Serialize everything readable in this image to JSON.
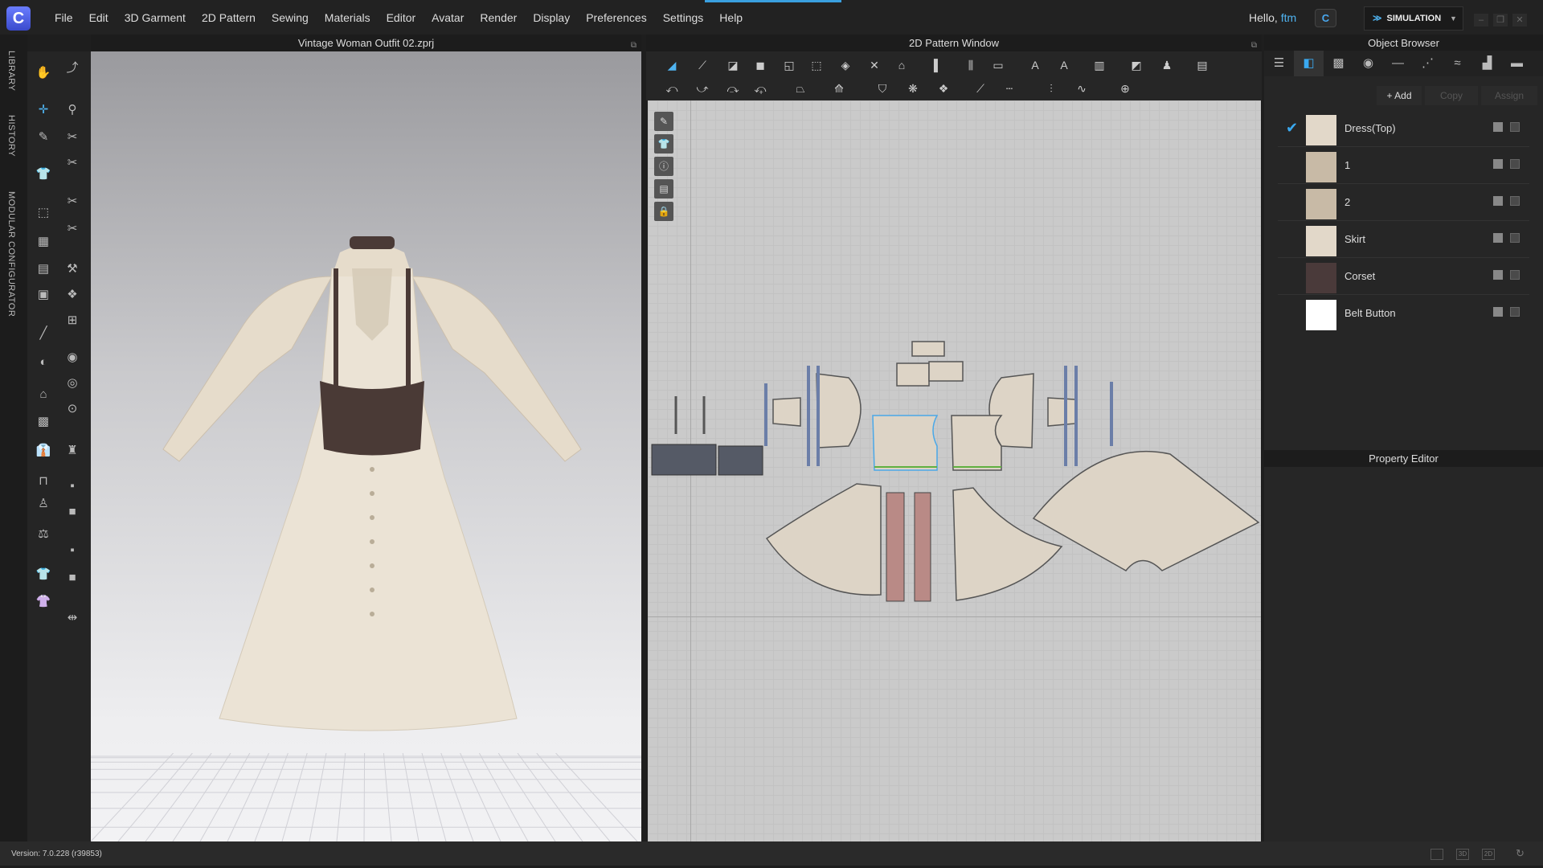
{
  "app": {
    "logo": "C",
    "menu": [
      "File",
      "Edit",
      "3D Garment",
      "2D Pattern",
      "Sewing",
      "Materials",
      "Editor",
      "Avatar",
      "Render",
      "Display",
      "Preferences",
      "Settings",
      "Help"
    ],
    "greeting": "Hello,",
    "user": "ftm",
    "cloud_icon": "C",
    "mode": "SIMULATION",
    "window_buttons": [
      "–",
      "❐",
      "✕"
    ]
  },
  "side_tabs": [
    "LIBRARY",
    "HISTORY",
    "MODULAR CONFIGURATOR"
  ],
  "viewport3d": {
    "title": "Vintage Woman Outfit 02.zprj"
  },
  "pattern2d": {
    "title": "2D Pattern Window"
  },
  "object_browser": {
    "title": "Object Browser",
    "add": "+ Add",
    "copy": "Copy",
    "assign": "Assign",
    "items": [
      {
        "name": "Dress(Top)",
        "color": "#e2d8c9",
        "checked": true
      },
      {
        "name": "1",
        "color": "#c8baa6"
      },
      {
        "name": "2",
        "color": "#c8baa6"
      },
      {
        "name": "Skirt",
        "color": "#e2d8c9"
      },
      {
        "name": "Corset",
        "color": "#4a3a3a"
      },
      {
        "name": "Belt Button",
        "color": "#ffffff"
      }
    ]
  },
  "property_editor": {
    "title": "Property Editor"
  },
  "status": {
    "version": "Version: 7.0.228 (r39853)",
    "view_buttons": [
      "",
      "3D",
      "2D"
    ]
  }
}
